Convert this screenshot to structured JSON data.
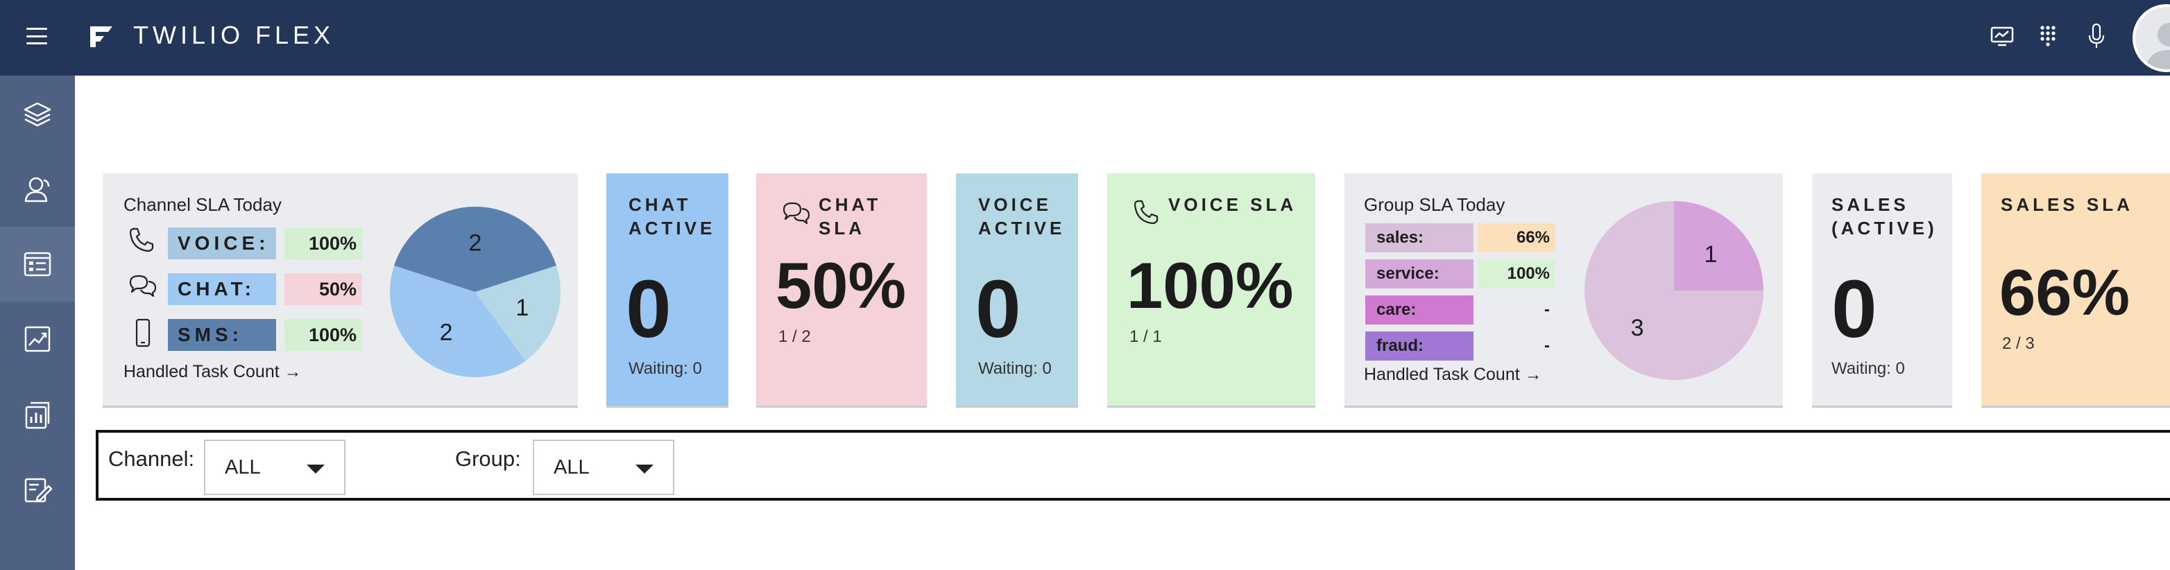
{
  "app": {
    "brand": "TWILIO FLEX"
  },
  "channel_sla": {
    "title": "Channel SLA Today",
    "rows": [
      {
        "label": "VOICE:",
        "value": "100%",
        "label_color": "#a7c8e1",
        "value_color": "#d5efd3"
      },
      {
        "label": "CHAT:",
        "value": "50%",
        "label_color": "#9ec9f3",
        "value_color": "#f5d3da"
      },
      {
        "label": "SMS:",
        "value": "100%",
        "label_color": "#5b80ac",
        "value_color": "#d5efd3"
      }
    ],
    "link": "Handled Task Count →",
    "pie": [
      {
        "label": "2",
        "value": 2,
        "color": "#5a80ad"
      },
      {
        "label": "1",
        "value": 1,
        "color": "#b5d8e7"
      },
      {
        "label": "2",
        "value": 2,
        "color": "#9ac6f1"
      }
    ]
  },
  "tiles": {
    "chat_active": {
      "title1": "CHAT",
      "title2": "ACTIVE",
      "value": "0",
      "waiting": "Waiting: 0",
      "color": "#99c6f2"
    },
    "chat_sla": {
      "title1": "CHAT",
      "title2": "SLA",
      "value": "50%",
      "sub": "1 / 2",
      "color": "#f5d1d8"
    },
    "voice_active": {
      "title1": "VOICE",
      "title2": "ACTIVE",
      "value": "0",
      "waiting": "Waiting: 0",
      "color": "#b5d8e6"
    },
    "voice_sla": {
      "title": "VOICE SLA",
      "value": "100%",
      "sub": "1 / 1",
      "color": "#d8f2d4"
    },
    "sales_active": {
      "title1": "SALES",
      "title2": "(ACTIVE)",
      "value": "0",
      "waiting": "Waiting: 0",
      "color": "#ebecef"
    },
    "sales_sla": {
      "title": "SALES SLA",
      "value": "66%",
      "sub": "2 / 3",
      "color": "#fce0bc"
    }
  },
  "group_sla": {
    "title": "Group SLA Today",
    "rows": [
      {
        "label": "sales:",
        "value": "66%",
        "label_color": "#d7bfd9",
        "value_color": "#fce0bc"
      },
      {
        "label": "service:",
        "value": "100%",
        "label_color": "#d4a9da",
        "value_color": "#d8f2d4"
      },
      {
        "label": "care:",
        "value": "-",
        "label_color": "#cf79d1",
        "value_color": "#ebecef"
      },
      {
        "label": "fraud:",
        "value": "-",
        "label_color": "#9f78d6",
        "value_color": "#ebecef"
      }
    ],
    "link": "Handled Task Count →",
    "pie": [
      {
        "label": "1",
        "value": 1,
        "color": "#d6a2db"
      },
      {
        "label": "3",
        "value": 3,
        "color": "#dcc3dd"
      }
    ]
  },
  "filters": {
    "channel_label": "Channel:",
    "channel_value": "ALL",
    "group_label": "Group:",
    "group_value": "ALL"
  },
  "icons": {
    "nav": [
      "layers-icon",
      "agents-icon",
      "queues-stats-icon",
      "analytics-icon",
      "reports-icon",
      "notes-icon"
    ],
    "top": [
      "monitor-icon",
      "dialpad-icon",
      "microphone-icon"
    ]
  },
  "colors": {
    "topbar": "#233659",
    "sidenav": "#4e6183",
    "panel": "#ebecef"
  }
}
